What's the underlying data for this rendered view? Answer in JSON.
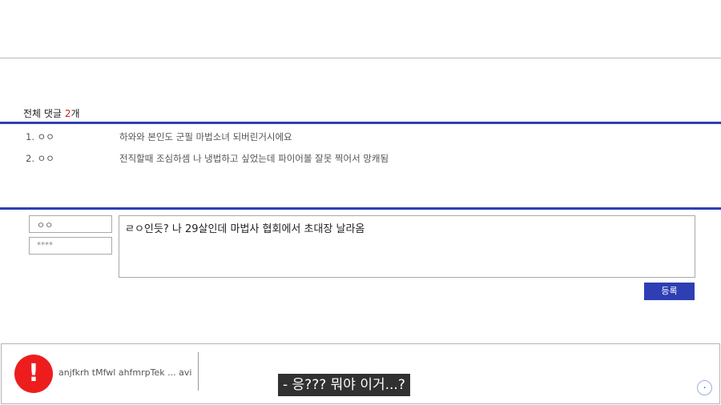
{
  "comments": {
    "label": "전체 댓글",
    "count": "2",
    "suffix": "개",
    "items": [
      {
        "index": "1.",
        "author": "ㅇㅇ",
        "text": "하와와 본인도 군필 마법소녀 되버린거시에요"
      },
      {
        "index": "2.",
        "author": "ㅇㅇ",
        "text": "전직할때 조심하셈 나 냉법하고 싶었는데 파이어볼 잘못 찍어서 망캐됨"
      }
    ]
  },
  "form": {
    "name_value": "ㅇㅇ",
    "password_value": "****",
    "comment_value": "ㄹㅇ인듯? 나 29살인데 마법사 협회에서 초대장 날라옴",
    "submit_label": "등록"
  },
  "player": {
    "alert_glyph": "!",
    "filename": "anjfkrh tMfwl ahfmrpTek ... avi"
  },
  "video": {
    "subtitle": "- 응??? 뭐야 이거...?"
  },
  "colors": {
    "accent": "#2d3fb3",
    "count_highlight": "#d21f1f",
    "alert": "#ee1d1d"
  }
}
